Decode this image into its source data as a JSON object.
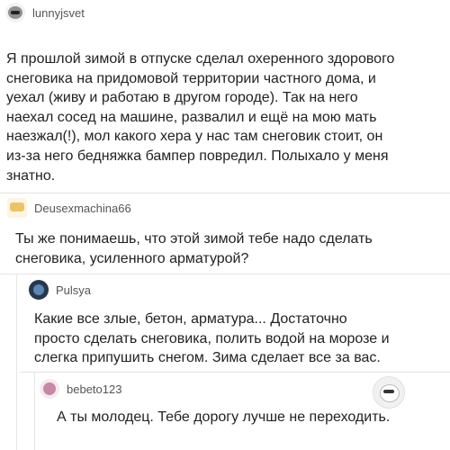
{
  "comments": [
    {
      "username": "lunnyjsvet",
      "avatar": "raccoon-avatar",
      "lines": [
        "Я прошлой зимой в отпуске сделал охеренного здорового",
        "снеговика на придомовой территории частного дома, и",
        "уехал (живу и работаю в другом городе). Так на него",
        "наехал сосед на машине, развалил и ещё на мою мать",
        "наезжал(!), мол какого хера у нас там снеговик стоит, он",
        "из-за него бедняжка бампер повредил. Полыхало у меня",
        "знатно."
      ]
    },
    {
      "username": "Deusexmachina66",
      "avatar": "deus-avatar",
      "lines": [
        "Ты же понимаешь, что этой зимой тебе надо сделать",
        "снеговика, усиленного арматурой?"
      ]
    },
    {
      "username": "Pulsya",
      "avatar": "pulsya-avatar",
      "lines": [
        "Какие все злые, бетон, арматура... Достаточно",
        "просто сделать снеговика, полить водой на морозе и",
        "слегка припушить снегом. Зима сделает все за вас."
      ]
    },
    {
      "username": "bebeto123",
      "avatar": "bebeto-avatar",
      "lines": [
        "А ты молодец. Тебе дорогу лучше не переходить."
      ]
    }
  ]
}
